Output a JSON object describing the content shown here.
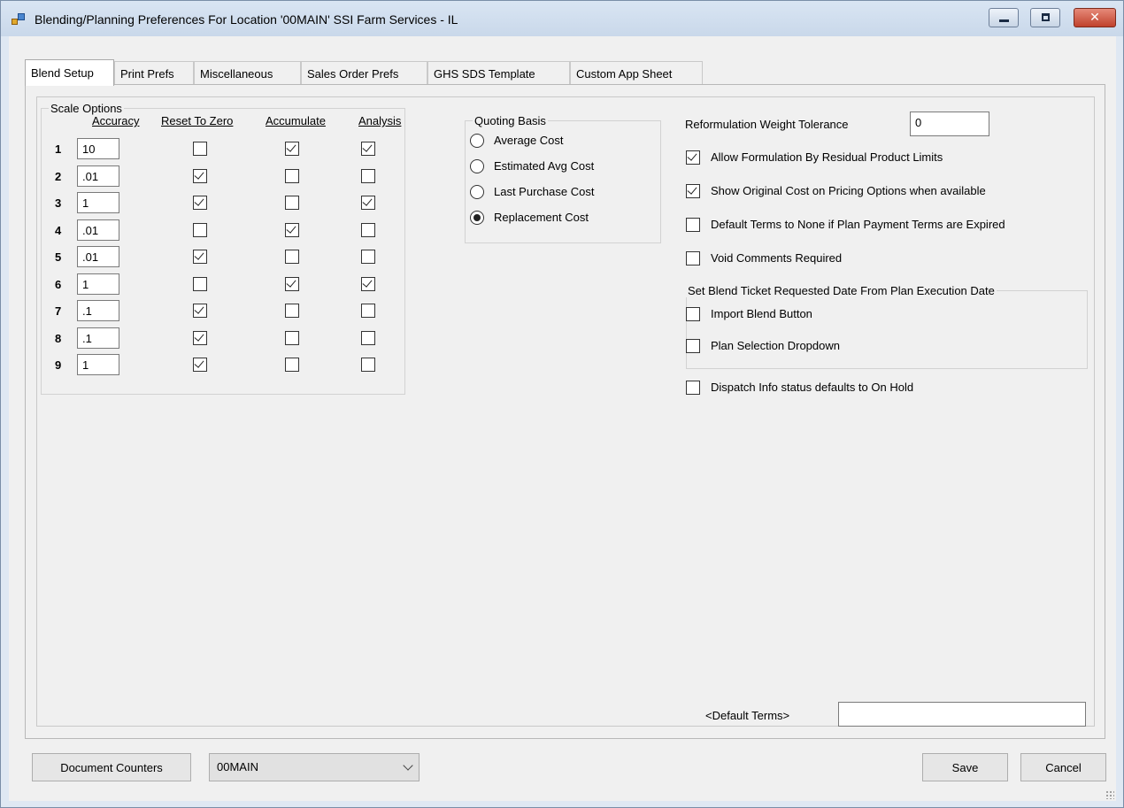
{
  "window": {
    "title": "Blending/Planning Preferences For Location '00MAIN' SSI Farm Services - IL"
  },
  "tabs": [
    {
      "label": "Blend Setup",
      "active": true
    },
    {
      "label": "Print Prefs",
      "active": false
    },
    {
      "label": "Miscellaneous",
      "active": false
    },
    {
      "label": "Sales Order Prefs",
      "active": false
    },
    {
      "label": "GHS SDS Template",
      "active": false
    },
    {
      "label": "Custom App Sheet",
      "active": false
    }
  ],
  "scale_options": {
    "legend": "Scale Options",
    "headers": {
      "accuracy": "Accuracy",
      "reset": "Reset To Zero",
      "accumulate": "Accumulate",
      "analysis": "Analysis"
    },
    "rows": [
      {
        "num": "1",
        "accuracy": "10",
        "reset": false,
        "accumulate": true,
        "analysis": true
      },
      {
        "num": "2",
        "accuracy": ".01",
        "reset": true,
        "accumulate": false,
        "analysis": false
      },
      {
        "num": "3",
        "accuracy": "1",
        "reset": true,
        "accumulate": false,
        "analysis": true
      },
      {
        "num": "4",
        "accuracy": ".01",
        "reset": false,
        "accumulate": true,
        "analysis": false
      },
      {
        "num": "5",
        "accuracy": ".01",
        "reset": true,
        "accumulate": false,
        "analysis": false
      },
      {
        "num": "6",
        "accuracy": "1",
        "reset": false,
        "accumulate": true,
        "analysis": true
      },
      {
        "num": "7",
        "accuracy": ".1",
        "reset": true,
        "accumulate": false,
        "analysis": false
      },
      {
        "num": "8",
        "accuracy": ".1",
        "reset": true,
        "accumulate": false,
        "analysis": false
      },
      {
        "num": "9",
        "accuracy": "1",
        "reset": true,
        "accumulate": false,
        "analysis": false
      }
    ]
  },
  "quoting_basis": {
    "legend": "Quoting Basis",
    "options": [
      {
        "label": "Average Cost",
        "selected": false
      },
      {
        "label": "Estimated Avg Cost",
        "selected": false
      },
      {
        "label": "Last Purchase Cost",
        "selected": false
      },
      {
        "label": "Replacement Cost",
        "selected": true
      }
    ]
  },
  "reformulation": {
    "label": "Reformulation Weight Tolerance",
    "value": "0"
  },
  "options": [
    {
      "label": "Allow Formulation By Residual Product Limits",
      "checked": true
    },
    {
      "label": "Show Original Cost on Pricing Options when available",
      "checked": true
    },
    {
      "label": "Default Terms to None if Plan Payment Terms are Expired",
      "checked": false
    },
    {
      "label": "Void Comments Required",
      "checked": false
    }
  ],
  "blend_ticket_group": {
    "legend": "Set Blend Ticket Requested Date From Plan Execution Date",
    "items": [
      {
        "label": "Import Blend Button",
        "checked": false
      },
      {
        "label": "Plan Selection Dropdown",
        "checked": false
      }
    ]
  },
  "dispatch": {
    "label": "Dispatch Info status defaults to On Hold",
    "checked": false
  },
  "default_terms": {
    "label": "<Default Terms>",
    "value": ""
  },
  "footer": {
    "document_counters": "Document Counters",
    "location": "00MAIN",
    "save": "Save",
    "cancel": "Cancel"
  }
}
